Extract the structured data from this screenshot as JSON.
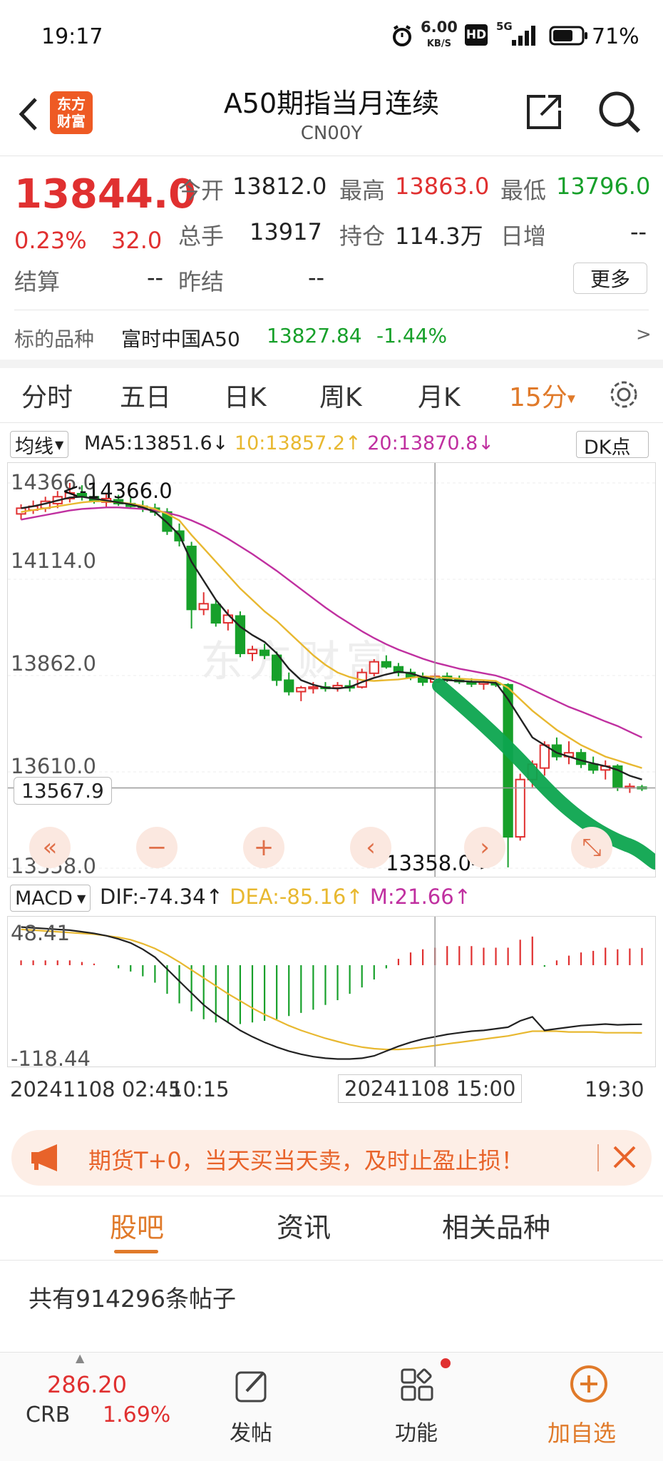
{
  "status": {
    "time": "19:17",
    "speed_value": "6.00",
    "speed_unit": "KB/S",
    "hd": "HD",
    "net": "5G",
    "battery": "71%",
    "battery_level": 0.71
  },
  "header": {
    "title": "A50期指当月连续",
    "code": "CN00Y",
    "logo_line1": "东方",
    "logo_line2": "财富"
  },
  "quote": {
    "price": "13844.0",
    "change_pct": "0.23%",
    "change": "32.0",
    "open_label": "今开",
    "open": "13812.0",
    "high_label": "最高",
    "high": "13863.0",
    "low_label": "最低",
    "low": "13796.0",
    "volume_label": "总手",
    "volume": "13917",
    "oi_label": "持仓",
    "oi": "114.3万",
    "daily_inc_label": "日增",
    "daily_inc": "--",
    "settle_label": "结算",
    "settle": "--",
    "prev_settle_label": "昨结",
    "prev_settle": "--",
    "more_button": "更多"
  },
  "underlying": {
    "label": "标的品种",
    "name": "富时中国A50",
    "price": "13827.84",
    "change": "-1.44%",
    "arrow": ">"
  },
  "tabs": [
    "分时",
    "五日",
    "日K",
    "周K",
    "月K",
    "15分"
  ],
  "active_tab_marker": "▾",
  "ma_bar": {
    "selector": "均线",
    "ma5": "MA5:13851.6",
    "ma5_arrow": "↓",
    "ma10": "10:13857.2",
    "ma10_arrow": "↑",
    "ma20": "20:13870.8",
    "ma20_arrow": "↓",
    "dk_button": "DK点"
  },
  "price_chart": {
    "y_labels": [
      "14366.0",
      "14114.0",
      "13862.0",
      "13610.0",
      "13358.0"
    ],
    "max_annotation": "<-14366.0",
    "min_annotation": "13358.0->",
    "crosshair_value": "13567.9",
    "watermark": "东方财富"
  },
  "macd_bar": {
    "selector": "MACD",
    "dif": "DIF:-74.34",
    "dif_arrow": "↑",
    "dea": "DEA:-85.16",
    "dea_arrow": "↑",
    "m": "M:21.66",
    "m_arrow": "↑"
  },
  "macd_chart": {
    "y_labels": [
      "48.41",
      "-118.44"
    ]
  },
  "x_labels": {
    "left": "20241108 02:45",
    "left2": "10:15",
    "middle": "20241108 15:00",
    "right": "19:30"
  },
  "banner": {
    "text": "期货T+0，当天买当天卖，及时止盈止损！"
  },
  "bottom_tabs": [
    "股吧",
    "资讯",
    "相关品种"
  ],
  "post_count": "共有914296条帖子",
  "bottom_nav": {
    "crb_value": "286.20",
    "crb_label": "CRB",
    "crb_change": "1.69%",
    "post": "发帖",
    "function": "功能",
    "add": "加自选"
  },
  "colors": {
    "up": "#e03030",
    "down": "#17a02a",
    "accent": "#e07a2a",
    "ma10": "#e8b830",
    "ma20": "#c030a0"
  },
  "chart_data": {
    "type": "candlestick",
    "ylim": [
      13358.0,
      14366.0
    ],
    "candles": [
      {
        "o": 14285,
        "h": 14310,
        "l": 14270,
        "c": 14300
      },
      {
        "o": 14295,
        "h": 14320,
        "l": 14285,
        "c": 14305
      },
      {
        "o": 14300,
        "h": 14330,
        "l": 14290,
        "c": 14318
      },
      {
        "o": 14312,
        "h": 14345,
        "l": 14300,
        "c": 14330
      },
      {
        "o": 14325,
        "h": 14366,
        "l": 14315,
        "c": 14340
      },
      {
        "o": 14338,
        "h": 14360,
        "l": 14320,
        "c": 14330
      },
      {
        "o": 14330,
        "h": 14350,
        "l": 14312,
        "c": 14318
      },
      {
        "o": 14316,
        "h": 14340,
        "l": 14300,
        "c": 14325
      },
      {
        "o": 14322,
        "h": 14335,
        "l": 14306,
        "c": 14312
      },
      {
        "o": 14312,
        "h": 14328,
        "l": 14298,
        "c": 14305
      },
      {
        "o": 14305,
        "h": 14320,
        "l": 14290,
        "c": 14300
      },
      {
        "o": 14300,
        "h": 14312,
        "l": 14280,
        "c": 14290
      },
      {
        "o": 14290,
        "h": 14300,
        "l": 14230,
        "c": 14240
      },
      {
        "o": 14240,
        "h": 14260,
        "l": 14200,
        "c": 14215
      },
      {
        "o": 14200,
        "h": 14212,
        "l": 13985,
        "c": 14035
      },
      {
        "o": 14035,
        "h": 14080,
        "l": 14020,
        "c": 14050
      },
      {
        "o": 14048,
        "h": 14060,
        "l": 13990,
        "c": 14000
      },
      {
        "o": 14000,
        "h": 14035,
        "l": 13980,
        "c": 14020
      },
      {
        "o": 14018,
        "h": 14030,
        "l": 13910,
        "c": 13920
      },
      {
        "o": 13920,
        "h": 13940,
        "l": 13900,
        "c": 13930
      },
      {
        "o": 13928,
        "h": 13945,
        "l": 13905,
        "c": 13915
      },
      {
        "o": 13915,
        "h": 13925,
        "l": 13835,
        "c": 13850
      },
      {
        "o": 13850,
        "h": 13870,
        "l": 13810,
        "c": 13820
      },
      {
        "o": 13820,
        "h": 13835,
        "l": 13795,
        "c": 13830
      },
      {
        "o": 13828,
        "h": 13845,
        "l": 13815,
        "c": 13832
      },
      {
        "o": 13832,
        "h": 13845,
        "l": 13820,
        "c": 13830
      },
      {
        "o": 13830,
        "h": 13845,
        "l": 13820,
        "c": 13836
      },
      {
        "o": 13835,
        "h": 13850,
        "l": 13820,
        "c": 13830
      },
      {
        "o": 13832,
        "h": 13880,
        "l": 13828,
        "c": 13870
      },
      {
        "o": 13868,
        "h": 13905,
        "l": 13860,
        "c": 13898
      },
      {
        "o": 13898,
        "h": 13915,
        "l": 13880,
        "c": 13885
      },
      {
        "o": 13885,
        "h": 13895,
        "l": 13860,
        "c": 13870
      },
      {
        "o": 13870,
        "h": 13880,
        "l": 13850,
        "c": 13858
      },
      {
        "o": 13858,
        "h": 13870,
        "l": 13835,
        "c": 13845
      },
      {
        "o": 13845,
        "h": 13868,
        "l": 13830,
        "c": 13860
      },
      {
        "o": 13860,
        "h": 13870,
        "l": 13845,
        "c": 13852
      },
      {
        "o": 13852,
        "h": 13862,
        "l": 13840,
        "c": 13846
      },
      {
        "o": 13846,
        "h": 13855,
        "l": 13832,
        "c": 13840
      },
      {
        "o": 13840,
        "h": 13850,
        "l": 13825,
        "c": 13845
      },
      {
        "o": 13842,
        "h": 13848,
        "l": 13832,
        "c": 13838
      },
      {
        "o": 13838,
        "h": 13842,
        "l": 13360,
        "c": 13440
      },
      {
        "o": 13440,
        "h": 13605,
        "l": 13430,
        "c": 13590
      },
      {
        "o": 13590,
        "h": 13640,
        "l": 13570,
        "c": 13630
      },
      {
        "o": 13620,
        "h": 13690,
        "l": 13600,
        "c": 13680
      },
      {
        "o": 13680,
        "h": 13700,
        "l": 13640,
        "c": 13650
      },
      {
        "o": 13650,
        "h": 13690,
        "l": 13630,
        "c": 13660
      },
      {
        "o": 13660,
        "h": 13670,
        "l": 13620,
        "c": 13630
      },
      {
        "o": 13630,
        "h": 13650,
        "l": 13605,
        "c": 13615
      },
      {
        "o": 13615,
        "h": 13640,
        "l": 13590,
        "c": 13625
      },
      {
        "o": 13625,
        "h": 13630,
        "l": 13560,
        "c": 13570
      },
      {
        "o": 13568,
        "h": 13580,
        "l": 13555,
        "c": 13572
      },
      {
        "o": 13570,
        "h": 13576,
        "l": 13560,
        "c": 13567.9
      }
    ],
    "ma5": [
      14300,
      14305,
      14312,
      14320,
      14328,
      14330,
      14325,
      14320,
      14315,
      14310,
      14302,
      14290,
      14262,
      14230,
      14160,
      14110,
      14060,
      14022,
      13990,
      13968,
      13950,
      13920,
      13880,
      13850,
      13838,
      13830,
      13828,
      13832,
      13845,
      13856,
      13865,
      13872,
      13868,
      13858,
      13852,
      13850,
      13848,
      13846,
      13845,
      13843,
      13800,
      13750,
      13700,
      13680,
      13660,
      13650,
      13640,
      13632,
      13625,
      13615,
      13600,
      13590
    ],
    "ma10": [
      14290,
      14295,
      14300,
      14305,
      14310,
      14315,
      14318,
      14318,
      14315,
      14312,
      14306,
      14298,
      14285,
      14268,
      14230,
      14195,
      14160,
      14125,
      14090,
      14060,
      14030,
      14005,
      13975,
      13945,
      13915,
      13890,
      13870,
      13858,
      13850,
      13848,
      13850,
      13852,
      13856,
      13860,
      13858,
      13856,
      13854,
      13852,
      13850,
      13848,
      13830,
      13800,
      13770,
      13745,
      13720,
      13700,
      13680,
      13665,
      13650,
      13640,
      13630,
      13620
    ],
    "ma20": [
      14270,
      14276,
      14282,
      14288,
      14294,
      14298,
      14300,
      14302,
      14302,
      14300,
      14298,
      14294,
      14288,
      14280,
      14268,
      14254,
      14238,
      14220,
      14200,
      14180,
      14158,
      14136,
      14112,
      14088,
      14064,
      14040,
      14018,
      13998,
      13978,
      13960,
      13944,
      13930,
      13918,
      13906,
      13896,
      13888,
      13880,
      13874,
      13868,
      13862,
      13852,
      13840,
      13825,
      13810,
      13795,
      13780,
      13768,
      13755,
      13742,
      13730,
      13715,
      13700
    ],
    "macd": {
      "ylim": [
        -118.44,
        48.41
      ],
      "dif": [
        48,
        47,
        46,
        45,
        44,
        42,
        40,
        37,
        33,
        28,
        20,
        10,
        -5,
        -20,
        -35,
        -50,
        -62,
        -72,
        -82,
        -90,
        -97,
        -103,
        -108,
        -112,
        -115,
        -117,
        -118,
        -118,
        -117,
        -114,
        -108,
        -102,
        -97,
        -93,
        -90,
        -87,
        -85,
        -83,
        -82,
        -80,
        -78,
        -70,
        -65,
        -82,
        -80,
        -78,
        -76,
        -75,
        -74,
        -75,
        -74.5,
        -74.34
      ],
      "dea": [
        45,
        44,
        43,
        42,
        41,
        40,
        39,
        37,
        35,
        32,
        27,
        21,
        13,
        4,
        -6,
        -16,
        -26,
        -36,
        -45,
        -54,
        -62,
        -69,
        -76,
        -82,
        -87,
        -92,
        -96,
        -100,
        -103,
        -105,
        -106,
        -106,
        -105,
        -103,
        -101,
        -99,
        -97,
        -95,
        -93,
        -91,
        -89,
        -86,
        -83,
        -83,
        -83,
        -84,
        -84,
        -84,
        -85,
        -85,
        -85,
        -85.16
      ],
      "hist": [
        6,
        6,
        6,
        6,
        6,
        4,
        2,
        0,
        -4,
        -8,
        -14,
        -22,
        -36,
        -48,
        -58,
        -68,
        -72,
        -72,
        -74,
        -72,
        -70,
        -68,
        -64,
        -60,
        -56,
        -50,
        -44,
        -36,
        -28,
        -18,
        -4,
        8,
        16,
        20,
        22,
        24,
        24,
        24,
        22,
        22,
        22,
        32,
        36,
        -2,
        6,
        12,
        16,
        18,
        22,
        20,
        21,
        21.66
      ]
    }
  }
}
